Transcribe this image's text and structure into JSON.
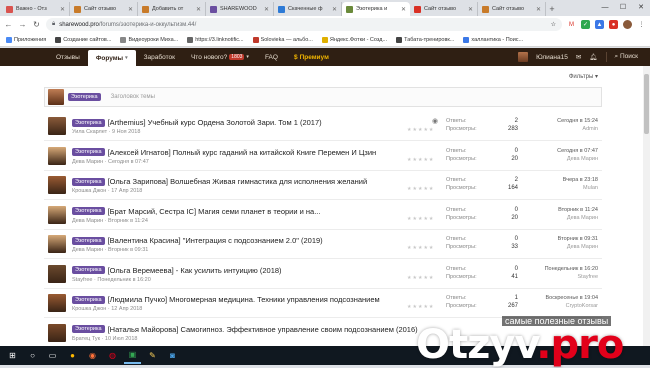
{
  "browser": {
    "tabs": [
      {
        "title": "Важно - Отз",
        "color": "#d9534f",
        "active": false
      },
      {
        "title": "Сайт отзыво",
        "color": "#c87b2a",
        "active": false
      },
      {
        "title": "Добавить от",
        "color": "#c87b2a",
        "active": false
      },
      {
        "title": "SHAREWOOD",
        "color": "#6a4ea0",
        "active": false
      },
      {
        "title": "Скаченные ф",
        "color": "#2d7ad6",
        "active": false
      },
      {
        "title": "Эзотерика и",
        "color": "#6a8a3a",
        "active": true
      },
      {
        "title": "Сайт отзыво",
        "color": "#d93025",
        "active": false
      },
      {
        "title": "Сайт отзыво",
        "color": "#c87b2a",
        "active": false
      }
    ],
    "new_tab": "+",
    "window_controls": [
      "—",
      "☐",
      "✕"
    ],
    "url_domain": "sharewood.pro",
    "url_path": "/forums/эзотерика-и-оккультизм.44/",
    "bookmarks": [
      {
        "label": "Приложения",
        "color": "#4a8af4"
      },
      {
        "label": "Создание сайтов...",
        "color": "#444"
      },
      {
        "label": "Видеоуроки Миха...",
        "color": "#888"
      },
      {
        "label": "https://3.linknotific...",
        "color": "#666"
      },
      {
        "label": "Solovieka — альбо...",
        "color": "#c0392b"
      },
      {
        "label": "Яндекс.Фотки - Созд...",
        "color": "#e0b000"
      },
      {
        "label": "Табата-тренировк...",
        "color": "#444"
      },
      {
        "label": "халлантика - Поис...",
        "color": "#3b78e7"
      }
    ]
  },
  "site": {
    "nav": {
      "items": [
        {
          "label": "Отзывы",
          "selected": false
        },
        {
          "label": "Форумы",
          "selected": true
        },
        {
          "label": "Заработок",
          "selected": false
        },
        {
          "label": "Что нового?",
          "selected": false
        },
        {
          "label": "FAQ",
          "selected": false
        },
        {
          "label": "Премиум",
          "selected": false
        }
      ],
      "new_count": "1803",
      "username": "Юлиана15",
      "search_label": "Поиск"
    },
    "filters_label": "Фильтры ▾",
    "new_thread": {
      "prefix": "Эзотерика",
      "placeholder": "Заголовок темы"
    },
    "stats_labels": {
      "replies": "Ответы:",
      "views": "Просмотры:"
    },
    "threads": [
      {
        "prefix": "Эзотерика",
        "title": "[Arthemius] Учебный курс Ордена Золотой Зари. Том 1 (2017)",
        "author": "Уила Скарлет",
        "date": "9 Ноя 2018",
        "replies": "2",
        "views": "283",
        "last_date": "Сегодня в 15:24",
        "last_user": "Admin",
        "av": "#8a5a3a",
        "lav": "#3a3a3a",
        "eye": true
      },
      {
        "prefix": "Эзотерика",
        "title": "[Алексей Игнатов] Полный курс гаданий на китайской Книге Перемен И Цзин",
        "author": "Дева Марин",
        "date": "Сегодня в 07:47",
        "replies": "0",
        "views": "20",
        "last_date": "Сегодня в 07:47",
        "last_user": "Дева Марин",
        "av": "#d6a978",
        "lav": "#d6a978",
        "eye": false
      },
      {
        "prefix": "Эзотерика",
        "title": "[Ольга Зарипова] Волшебная Живая гимнастика для исполнения желаний",
        "author": "Крошка Джон",
        "date": "17 Апр 2018",
        "replies": "2",
        "views": "164",
        "last_date": "Вчера в 23:18",
        "last_user": "Mulan",
        "av": "#9a5b33",
        "lav": "#caa07a",
        "eye": false
      },
      {
        "prefix": "Эзотерика",
        "title": "[Брат Марсий, Сестра IC] Магия семи планет в теории и на...",
        "author": "Дева Марин",
        "date": "Вторник в 11:24",
        "replies": "0",
        "views": "20",
        "last_date": "Вторник в 11:24",
        "last_user": "Дева Марин",
        "av": "#d6a978",
        "lav": "#d6a978",
        "eye": false
      },
      {
        "prefix": "Эзотерика",
        "title": "[Валентина Красина] \"Интеграция с подсознанием 2.0\" (2019)",
        "author": "Дева Марин",
        "date": "Вторник в 09:31",
        "replies": "0",
        "views": "33",
        "last_date": "Вторник в 09:31",
        "last_user": "Дева Марин",
        "av": "#d6a978",
        "lav": "#d6a978",
        "eye": false
      },
      {
        "prefix": "Эзотерика",
        "title": "[Ольга Веремеева] - Как усилить интуицию (2018)",
        "author": "Stayfree",
        "date": "Понедельник в 16:20",
        "replies": "0",
        "views": "41",
        "last_date": "Понедельник в 16:20",
        "last_user": "Stayfree",
        "av": "#6b4a2e",
        "lav": "#6b4a2e",
        "eye": false
      },
      {
        "prefix": "Эзотерика",
        "title": "[Людмила Пучко] Многомерная медицина. Техники управления подсознанием",
        "author": "Крошка Джон",
        "date": "12 Апр 2018",
        "replies": "1",
        "views": "267",
        "last_date": "Воскресенье в 19:04",
        "last_user": "CryptoKorsar",
        "av": "#9a5b33",
        "lav": "#4a4a4a",
        "eye": false
      },
      {
        "prefix": "Эзотерика",
        "title": "[Наталья Майорова] Самогипноз. Эффективное управление своим подсознанием (2016)",
        "author": "Братец Тук",
        "date": "10 Июл 2018",
        "replies": "",
        "views": "",
        "last_date": "",
        "last_user": "",
        "av": "#7a4a2a",
        "lav": "#7a4a2a",
        "eye": false
      }
    ]
  },
  "taskbar": {
    "icons": [
      "⊞",
      "○",
      "▭",
      "●",
      "◉",
      "◍",
      "▣",
      "✎",
      "◙"
    ]
  },
  "watermark": {
    "tagline": "самые полезные отзывы",
    "logo_main": "Otzyv",
    "logo_suffix": ".pro"
  },
  "colors": {
    "site_nav_bg": "#2f1f13",
    "prefix_bg": "#6a4ea0",
    "new_badge": "#c0392b",
    "premium": "#f0b400",
    "taskbar_bg": "#101820"
  }
}
